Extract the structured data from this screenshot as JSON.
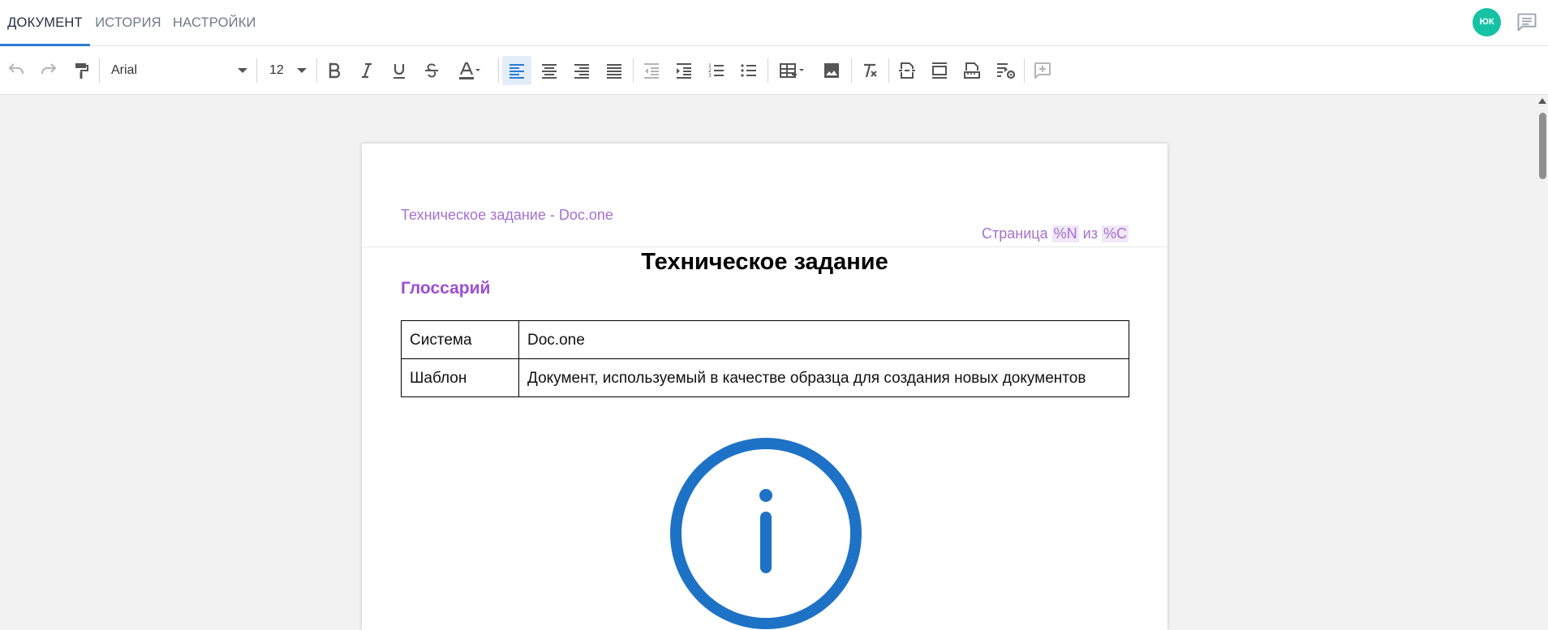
{
  "tabs": [
    {
      "label": "ДОКУМЕНТ",
      "active": true
    },
    {
      "label": "ИСТОРИЯ",
      "active": false
    },
    {
      "label": "НАСТРОЙКИ",
      "active": false
    }
  ],
  "user": {
    "initials": "ЮК"
  },
  "toolbar": {
    "font_family": "Arial",
    "font_size": "12",
    "buttons": [
      "undo-icon",
      "redo-icon",
      "format-painter-icon",
      "bold-icon",
      "italic-icon",
      "underline-icon",
      "strikethrough-icon",
      "text-color-icon",
      "align-left-icon",
      "align-center-icon",
      "align-right-icon",
      "justify-icon",
      "outdent-icon",
      "indent-icon",
      "numbered-list-icon",
      "bulleted-list-icon",
      "table-icon",
      "image-icon",
      "clear-format-icon",
      "page-break-icon",
      "header-footer-icon",
      "page-setup-icon",
      "field-settings-icon",
      "add-comment-icon"
    ],
    "accent": "#2b7ad6"
  },
  "page": {
    "header_left": "Техническое задание - Doc.one",
    "header_right": {
      "prefix": "Страница",
      "page_field": "%N",
      "middle": "из",
      "count_field": "%C"
    },
    "title": "Техническое задание",
    "glossary_heading": "Глоссарий",
    "glossary": [
      {
        "term": "Система",
        "definition": "Doc.one"
      },
      {
        "term": "Шаблон",
        "definition": "Документ, используемый в качестве образца для создания новых документов"
      }
    ],
    "image_icon": "info-circle-icon",
    "image_color": "#1e72c6"
  }
}
